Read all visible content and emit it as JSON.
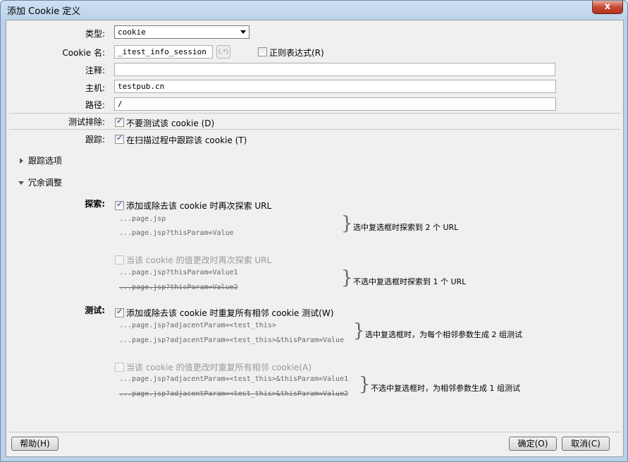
{
  "window": {
    "title": "添加 Cookie 定义",
    "close": "x"
  },
  "form": {
    "type_label": "类型:",
    "type_value": "cookie",
    "name_label": "Cookie 名:",
    "name_value": "_itest_info_session",
    "regex_btn": "(.*)",
    "regex_label": "正则表达式(R)",
    "comment_label": "注释:",
    "comment_value": "",
    "host_label": "主机:",
    "host_value": "testpub.cn",
    "path_label": "路径:",
    "path_value": "/",
    "exclude_label": "测试排除:",
    "exclude_cb": "不要测试该 cookie (D)",
    "track_label": "跟踪:",
    "track_cb": "在扫描过程中跟踪该 cookie (T)"
  },
  "sections": {
    "tracking_options": "跟踪选项",
    "redundancy": "冗余调整"
  },
  "explore": {
    "label": "探索:",
    "cb1": "添加或除去该 cookie 时再次探索 URL",
    "ex1": [
      "...page.jsp",
      "...page.jsp?thisParam=Value"
    ],
    "note1": "选中复选框时探索到 2 个 URL",
    "cb2": "当该 cookie 的值更改时再次探索 URL",
    "ex2": [
      "...page.jsp?thisParam=Value1",
      "...page.jsp?thisParam=Value2"
    ],
    "note2": "不选中复选框时探索到 1 个 URL"
  },
  "test": {
    "label": "测试:",
    "cb1": "添加或除去该 cookie 时重复所有相邻 cookie 测试(W)",
    "ex1": [
      "...page.jsp?adjacentParam=<test_this>",
      "...page.jsp?adjacentParam=<test_this>&thisParam=Value"
    ],
    "note1": "选中复选框时，为每个相邻参数生成 2 组测试",
    "cb2": "当该 cookie 的值更改时重复所有相邻 cookie(A)",
    "ex2": [
      "...page.jsp?adjacentParam=<test_this>&thisParam=Value1",
      "...page.jsp?adjacentParam=<test_this>&thisParam=Value2"
    ],
    "note2": "不选中复选框时，为相邻参数生成 1 组测试"
  },
  "buttons": {
    "help": "帮助(H)",
    "ok": "确定(O)",
    "cancel": "取消(C)"
  }
}
